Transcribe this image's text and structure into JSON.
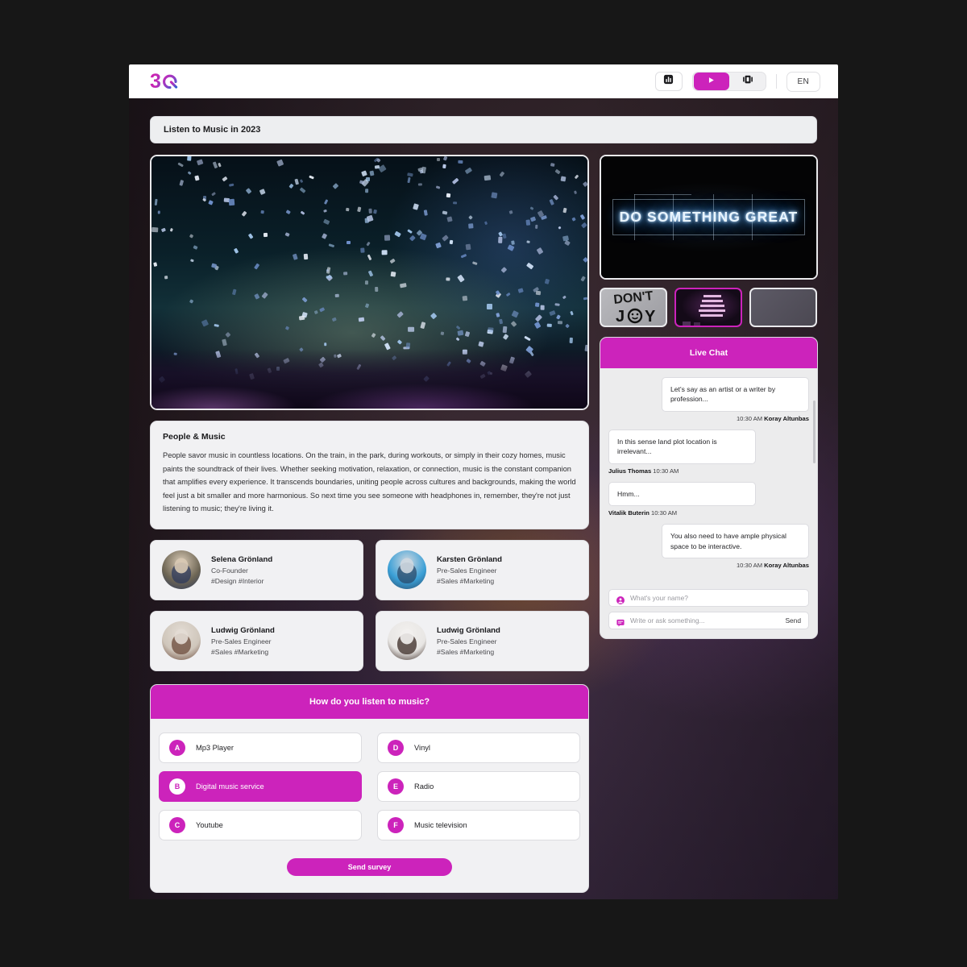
{
  "theme": {
    "accent": "#cc23bb",
    "panel": "#f1f1f3",
    "page_bg": "#171717"
  },
  "topbar": {
    "logo_text": "3",
    "logo_mark": "Q",
    "logo_name": "3Q",
    "buttons": [
      {
        "name": "stats-icon",
        "label": ""
      },
      {
        "name": "play-icon",
        "label": ""
      },
      {
        "name": "film-icon",
        "label": ""
      }
    ],
    "language": "EN"
  },
  "page": {
    "title": "Listen to Music in 2023"
  },
  "hero": {
    "alt": "Concert confetti over a crowd"
  },
  "article": {
    "heading": "People & Music",
    "body": "People savor music in countless locations. On the train, in the park, during workouts, or simply in their cozy homes, music paints the soundtrack of their lives. Whether seeking motivation, relaxation, or connection, music is the constant companion that amplifies every experience. It transcends boundaries, uniting people across cultures and backgrounds, making the world feel just a bit smaller and more harmonious. So next time you see someone with headphones in, remember, they're not just listening to music; they're living it."
  },
  "people": [
    {
      "name": "Selena Grönland",
      "role": "Co-Founder",
      "tags": "#Design #Interior"
    },
    {
      "name": "Karsten Grönland",
      "role": "Pre-Sales Engineer",
      "tags": "#Sales #Marketing"
    },
    {
      "name": "Ludwig Grönland",
      "role": "Pre-Sales Engineer",
      "tags": "#Sales #Marketing"
    },
    {
      "name": "Ludwig Grönland",
      "role": "Pre-Sales Engineer",
      "tags": "#Sales #Marketing"
    }
  ],
  "survey": {
    "question": "How do you listen to music?",
    "options": [
      {
        "key": "A",
        "label": "Mp3 Player",
        "selected": false
      },
      {
        "key": "B",
        "label": "Digital music service",
        "selected": true
      },
      {
        "key": "C",
        "label": "Youtube",
        "selected": false
      },
      {
        "key": "D",
        "label": "Vinyl",
        "selected": false
      },
      {
        "key": "E",
        "label": "Radio",
        "selected": false
      },
      {
        "key": "F",
        "label": "Music television",
        "selected": false
      }
    ],
    "submit_label": "Send survey"
  },
  "video": {
    "neon_text": "DO SOMETHING GREAT",
    "thumbnails": [
      {
        "caption": "JOY",
        "selected": false
      },
      {
        "caption": "",
        "selected": true
      },
      {
        "caption": "",
        "selected": false
      }
    ]
  },
  "chat": {
    "title": "Live Chat",
    "messages": [
      {
        "text": "Let's say as an artist or a writer by profession...",
        "time": "10:30 AM",
        "author": "Koray Altunbas",
        "side": "out"
      },
      {
        "text": "In this sense land plot location is irrelevant...",
        "time": "10:30 AM",
        "author": "Julius Thomas",
        "side": "in"
      },
      {
        "text": "Hmm...",
        "time": "10:30 AM",
        "author": "Vitalik Buterin",
        "side": "in"
      },
      {
        "text": "You also need to have ample physical space to be interactive.",
        "time": "10:30 AM",
        "author": "Koray Altunbas",
        "side": "out"
      }
    ],
    "name_placeholder": "What's your name?",
    "message_placeholder": "Write or ask something...",
    "send_label": "Send"
  }
}
